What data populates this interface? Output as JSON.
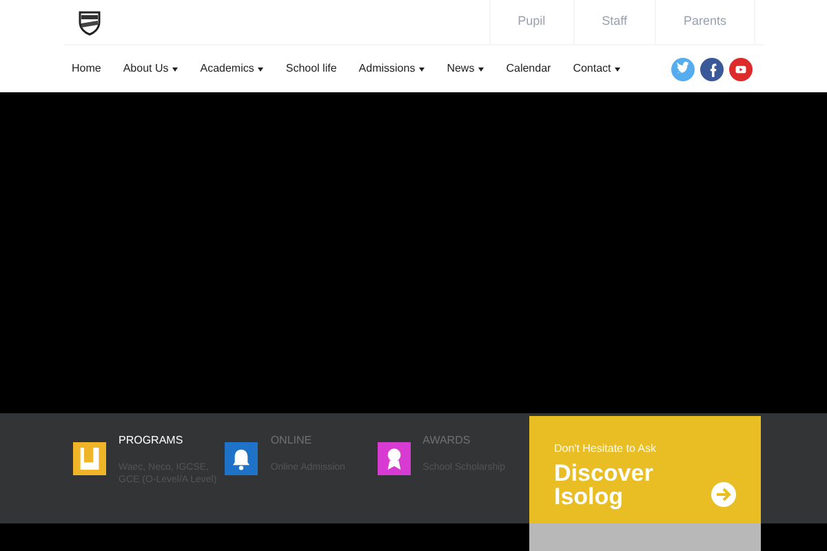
{
  "top_links": [
    "Pupil",
    "Staff",
    "Parents"
  ],
  "nav": [
    {
      "label": "Home",
      "dropdown": false
    },
    {
      "label": "About Us",
      "dropdown": true
    },
    {
      "label": "Academics",
      "dropdown": true
    },
    {
      "label": "School life",
      "dropdown": false
    },
    {
      "label": "Admissions",
      "dropdown": true
    },
    {
      "label": "News",
      "dropdown": true
    },
    {
      "label": "Calendar",
      "dropdown": false
    },
    {
      "label": "Contact",
      "dropdown": true
    }
  ],
  "social": [
    {
      "kind": "twitter",
      "color": "#55acee"
    },
    {
      "kind": "facebook",
      "color": "#3b5998"
    },
    {
      "kind": "youtube",
      "color": "#dd2a2a"
    }
  ],
  "features": [
    {
      "kind": "book",
      "color": "#f0b429",
      "title": "PROGRAMS",
      "text": "Waec, Neco, IGCSE, GCE (O-Level/A Level)",
      "faded": false
    },
    {
      "kind": "bell",
      "color": "#1e73c8",
      "title": "ONLINE",
      "text": "Online Admission",
      "faded": true
    },
    {
      "kind": "award",
      "color": "#d83bd2",
      "title": "AWARDS",
      "text": "School Scholarship",
      "faded": true
    }
  ],
  "cta": {
    "subtitle": "Don't Hesitate to Ask",
    "title": "Discover Isolog"
  }
}
